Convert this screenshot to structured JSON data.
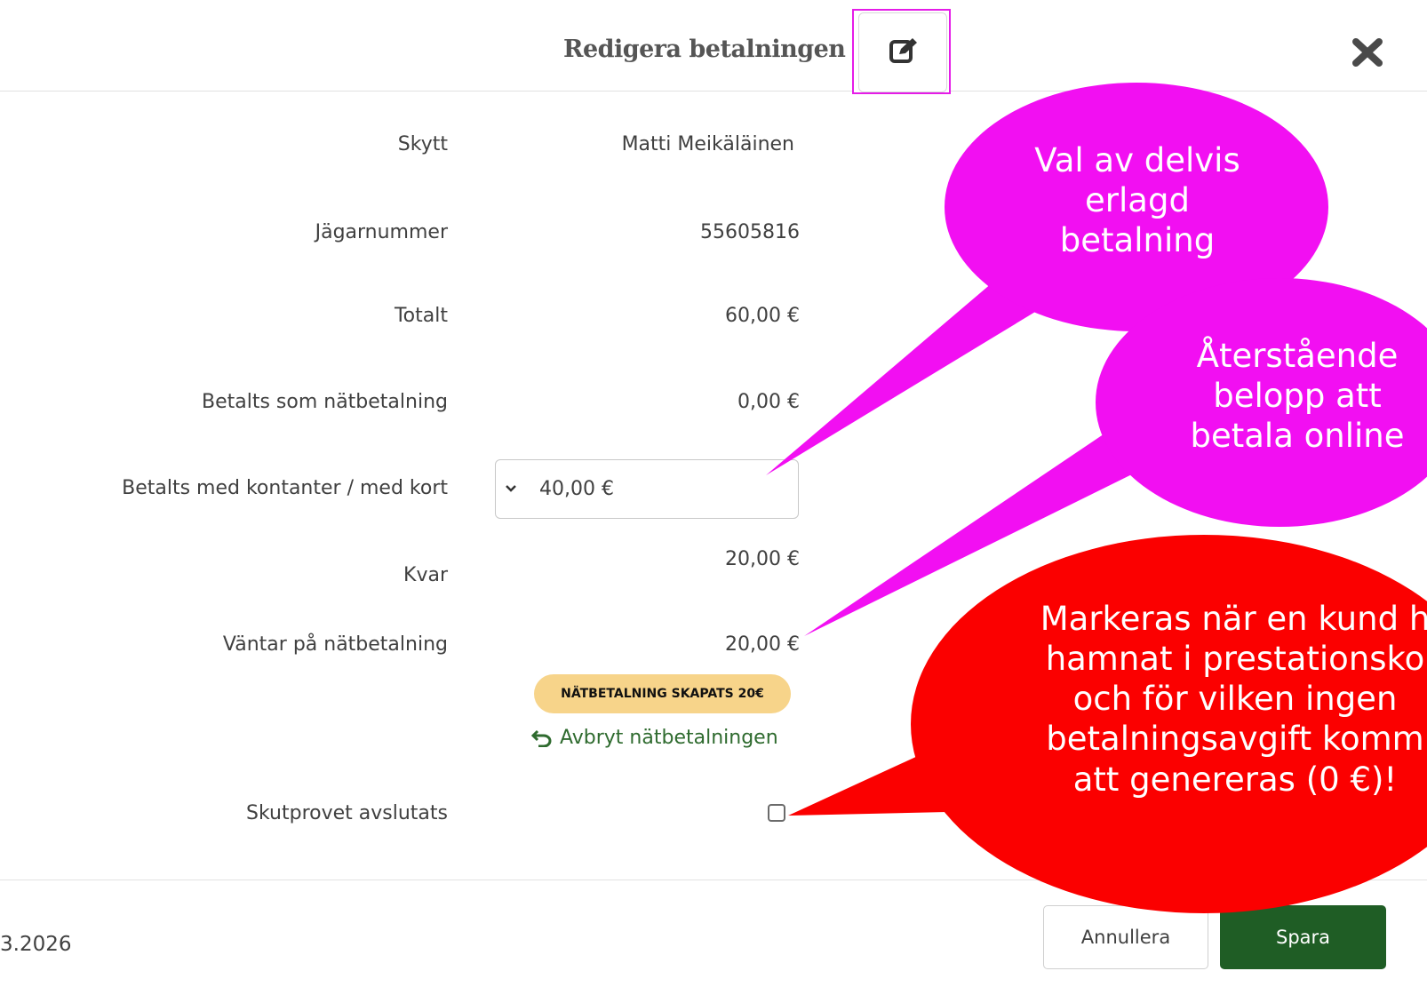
{
  "header": {
    "title": "Redigera betalningen",
    "edit_icon": "edit-icon",
    "close_icon": "close-icon"
  },
  "form": {
    "rows": [
      {
        "label": "Skytt",
        "value": "Matti Meikäläinen"
      },
      {
        "label": "Jägarnummer",
        "value": "55605816"
      },
      {
        "label": "Totalt",
        "value": "60,00 €"
      },
      {
        "label": "Betalts som nätbetalning",
        "value": "0,00 €"
      },
      {
        "label": "Betalts med kontanter / med kort",
        "value": "40,00 €"
      },
      {
        "label": "Kvar",
        "value": "20,00 €"
      },
      {
        "label": "Väntar på nätbetalning",
        "value": "20,00 €"
      },
      {
        "label": "Skutprovet avslutats",
        "value": ""
      }
    ],
    "badge": "NÄTBETALNING SKAPATS 20€",
    "cancel_payment_link": "Avbryt nätbetalningen",
    "checkbox_checked": false
  },
  "footer": {
    "date_partial": "3.2026",
    "cancel_label": "Annullera",
    "save_label": "Spara"
  },
  "annotations": {
    "bubble1": [
      "Val av delvis",
      "erlagd",
      "betalning"
    ],
    "bubble2": [
      "Återstående",
      "belopp att",
      "betala online"
    ],
    "bubble3": [
      "Markeras när en kund h",
      "hamnat i prestationsko",
      "och för vilken ingen",
      "betalningsavgift komm",
      "att genereras (0 €)!"
    ]
  },
  "colors": {
    "accent_green": "#1f5d25",
    "badge_yellow": "#f7d48a",
    "annotation_magenta": "#f20ff2",
    "annotation_red": "#fb0000"
  }
}
